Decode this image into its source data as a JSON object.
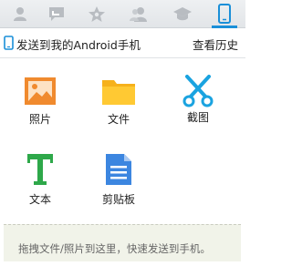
{
  "tabs": [
    {
      "icon": "user-icon",
      "active": false
    },
    {
      "icon": "chat-icon",
      "active": false
    },
    {
      "icon": "star-icon",
      "active": false
    },
    {
      "icon": "contacts-icon",
      "active": false
    },
    {
      "icon": "graduation-cap-icon",
      "active": false
    },
    {
      "icon": "phone-icon",
      "active": true
    }
  ],
  "header": {
    "title": "发送到我的Android手机",
    "history_label": "查看历史"
  },
  "items": [
    {
      "label": "照片",
      "icon": "photo-icon"
    },
    {
      "label": "文件",
      "icon": "folder-icon"
    },
    {
      "label": "截图",
      "icon": "scissors-icon"
    },
    {
      "label": "文本",
      "icon": "text-icon"
    },
    {
      "label": "剪贴板",
      "icon": "clipboard-icon"
    }
  ],
  "dropzone": {
    "text": "拖拽文件/照片到这里，快速发送到手机。"
  },
  "colors": {
    "accent": "#1a8fd8",
    "photo": "#f08a2e",
    "folder": "#f6b11b",
    "scissors": "#1aa3e0",
    "text_icon": "#2ea84a",
    "clipboard": "#3c86e0"
  }
}
